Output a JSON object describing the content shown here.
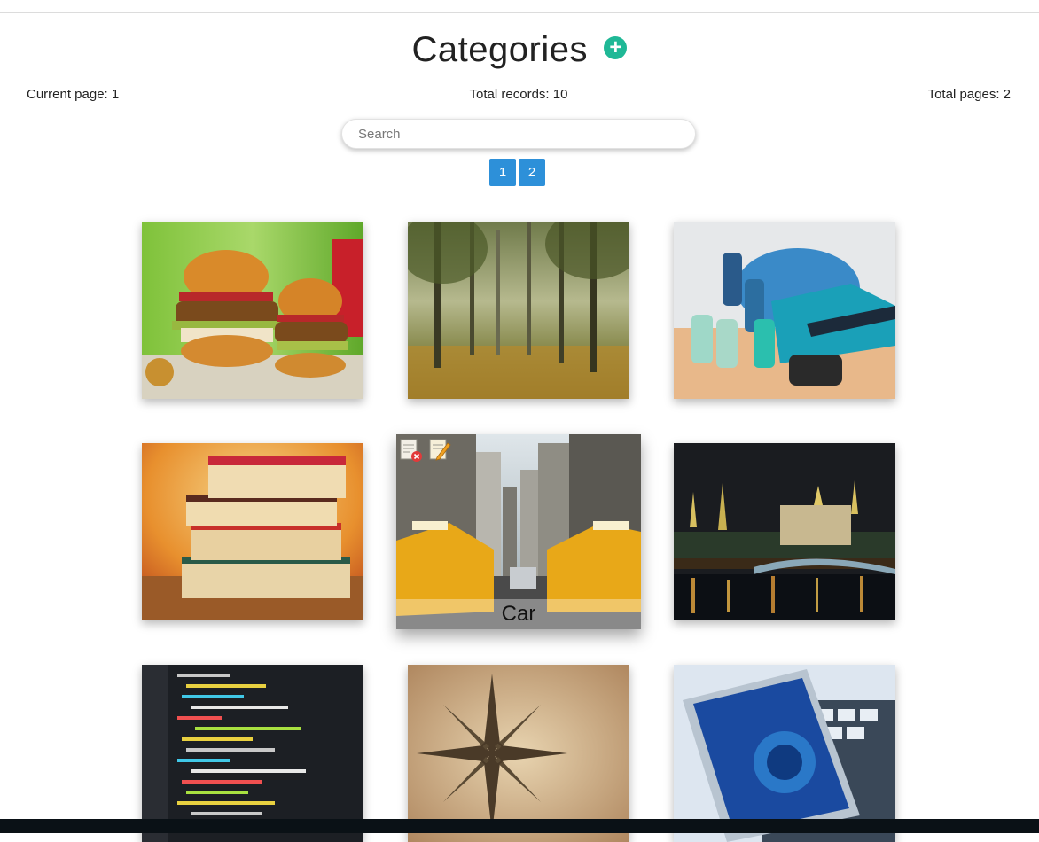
{
  "header": {
    "title": "Categories",
    "add_icon": "plus-circle-icon",
    "add_color": "#1fb896"
  },
  "stats": {
    "current_page": "Current page: 1",
    "total_records": "Total records: 10",
    "total_pages": "Total pages: 2"
  },
  "search": {
    "placeholder": "Search",
    "value": ""
  },
  "pagination": {
    "pages": [
      "1",
      "2"
    ],
    "color": "#2d90d9"
  },
  "categories": [
    {
      "image": "burgers"
    },
    {
      "image": "forest"
    },
    {
      "image": "dumbbells-and-sneakers"
    },
    {
      "image": "stack-of-books"
    },
    {
      "image": "city-taxis",
      "label": "Car",
      "hovered": true,
      "actions": [
        "delete-icon",
        "edit-icon"
      ]
    },
    {
      "image": "kremlin-at-night"
    },
    {
      "image": "source-code"
    },
    {
      "image": "compass-rose-map"
    },
    {
      "image": "social-phone-keyboard"
    }
  ]
}
